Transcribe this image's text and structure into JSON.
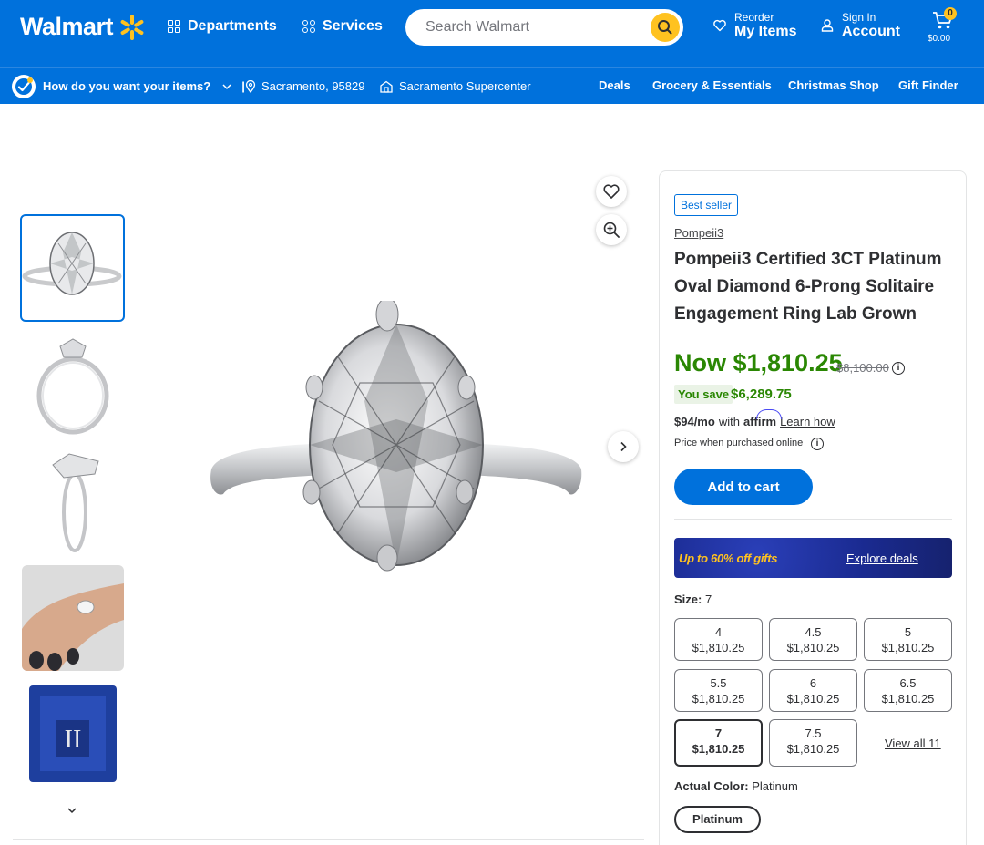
{
  "header": {
    "logo_text": "Walmart",
    "departments_label": "Departments",
    "services_label": "Services",
    "search_placeholder": "Search Walmart",
    "reorder_small": "Reorder",
    "reorder_big": "My Items",
    "signin_small": "Sign In",
    "signin_big": "Account",
    "cart_count": "0",
    "cart_total": "$0.00"
  },
  "subbar": {
    "delivery_prompt": "How do you want your items?",
    "location": "Sacramento, 95829",
    "store": "Sacramento Supercenter",
    "links": [
      "Deals",
      "Grocery & Essentials",
      "Christmas Shop",
      "Gift Finder"
    ]
  },
  "product": {
    "badge": "Best seller",
    "brand": "Pompeii3",
    "title": "Pompeii3 Certified 3CT Platinum Oval Diamond 6-Prong Solitaire Engagement Ring Lab Grown",
    "price_now": "Now $1,810.25",
    "price_was": "$8,100.00",
    "you_save_label": "You save",
    "you_save_value": "$6,289.75",
    "affirm_price": "$94/mo",
    "affirm_with": "with",
    "affirm_brand": "affirm",
    "affirm_link": "Learn how",
    "price_note": "Price when purchased online",
    "add_to_cart": "Add to cart",
    "promo_text": "Up to 60% off gifts",
    "promo_link": "Explore deals",
    "size_label": "Size:",
    "size_value": "7",
    "sizes": [
      {
        "size": "4",
        "price": "$1,810.25"
      },
      {
        "size": "4.5",
        "price": "$1,810.25"
      },
      {
        "size": "5",
        "price": "$1,810.25"
      },
      {
        "size": "5.5",
        "price": "$1,810.25"
      },
      {
        "size": "6",
        "price": "$1,810.25"
      },
      {
        "size": "6.5",
        "price": "$1,810.25"
      },
      {
        "size": "7",
        "price": "$1,810.25"
      },
      {
        "size": "7.5",
        "price": "$1,810.25"
      }
    ],
    "view_all": "View all 11",
    "color_label": "Actual Color:",
    "color_value": "Platinum",
    "color_option": "Platinum"
  },
  "colors": {
    "brand_blue": "#0071dc",
    "spark_yellow": "#ffc220",
    "price_green": "#2a8703"
  }
}
